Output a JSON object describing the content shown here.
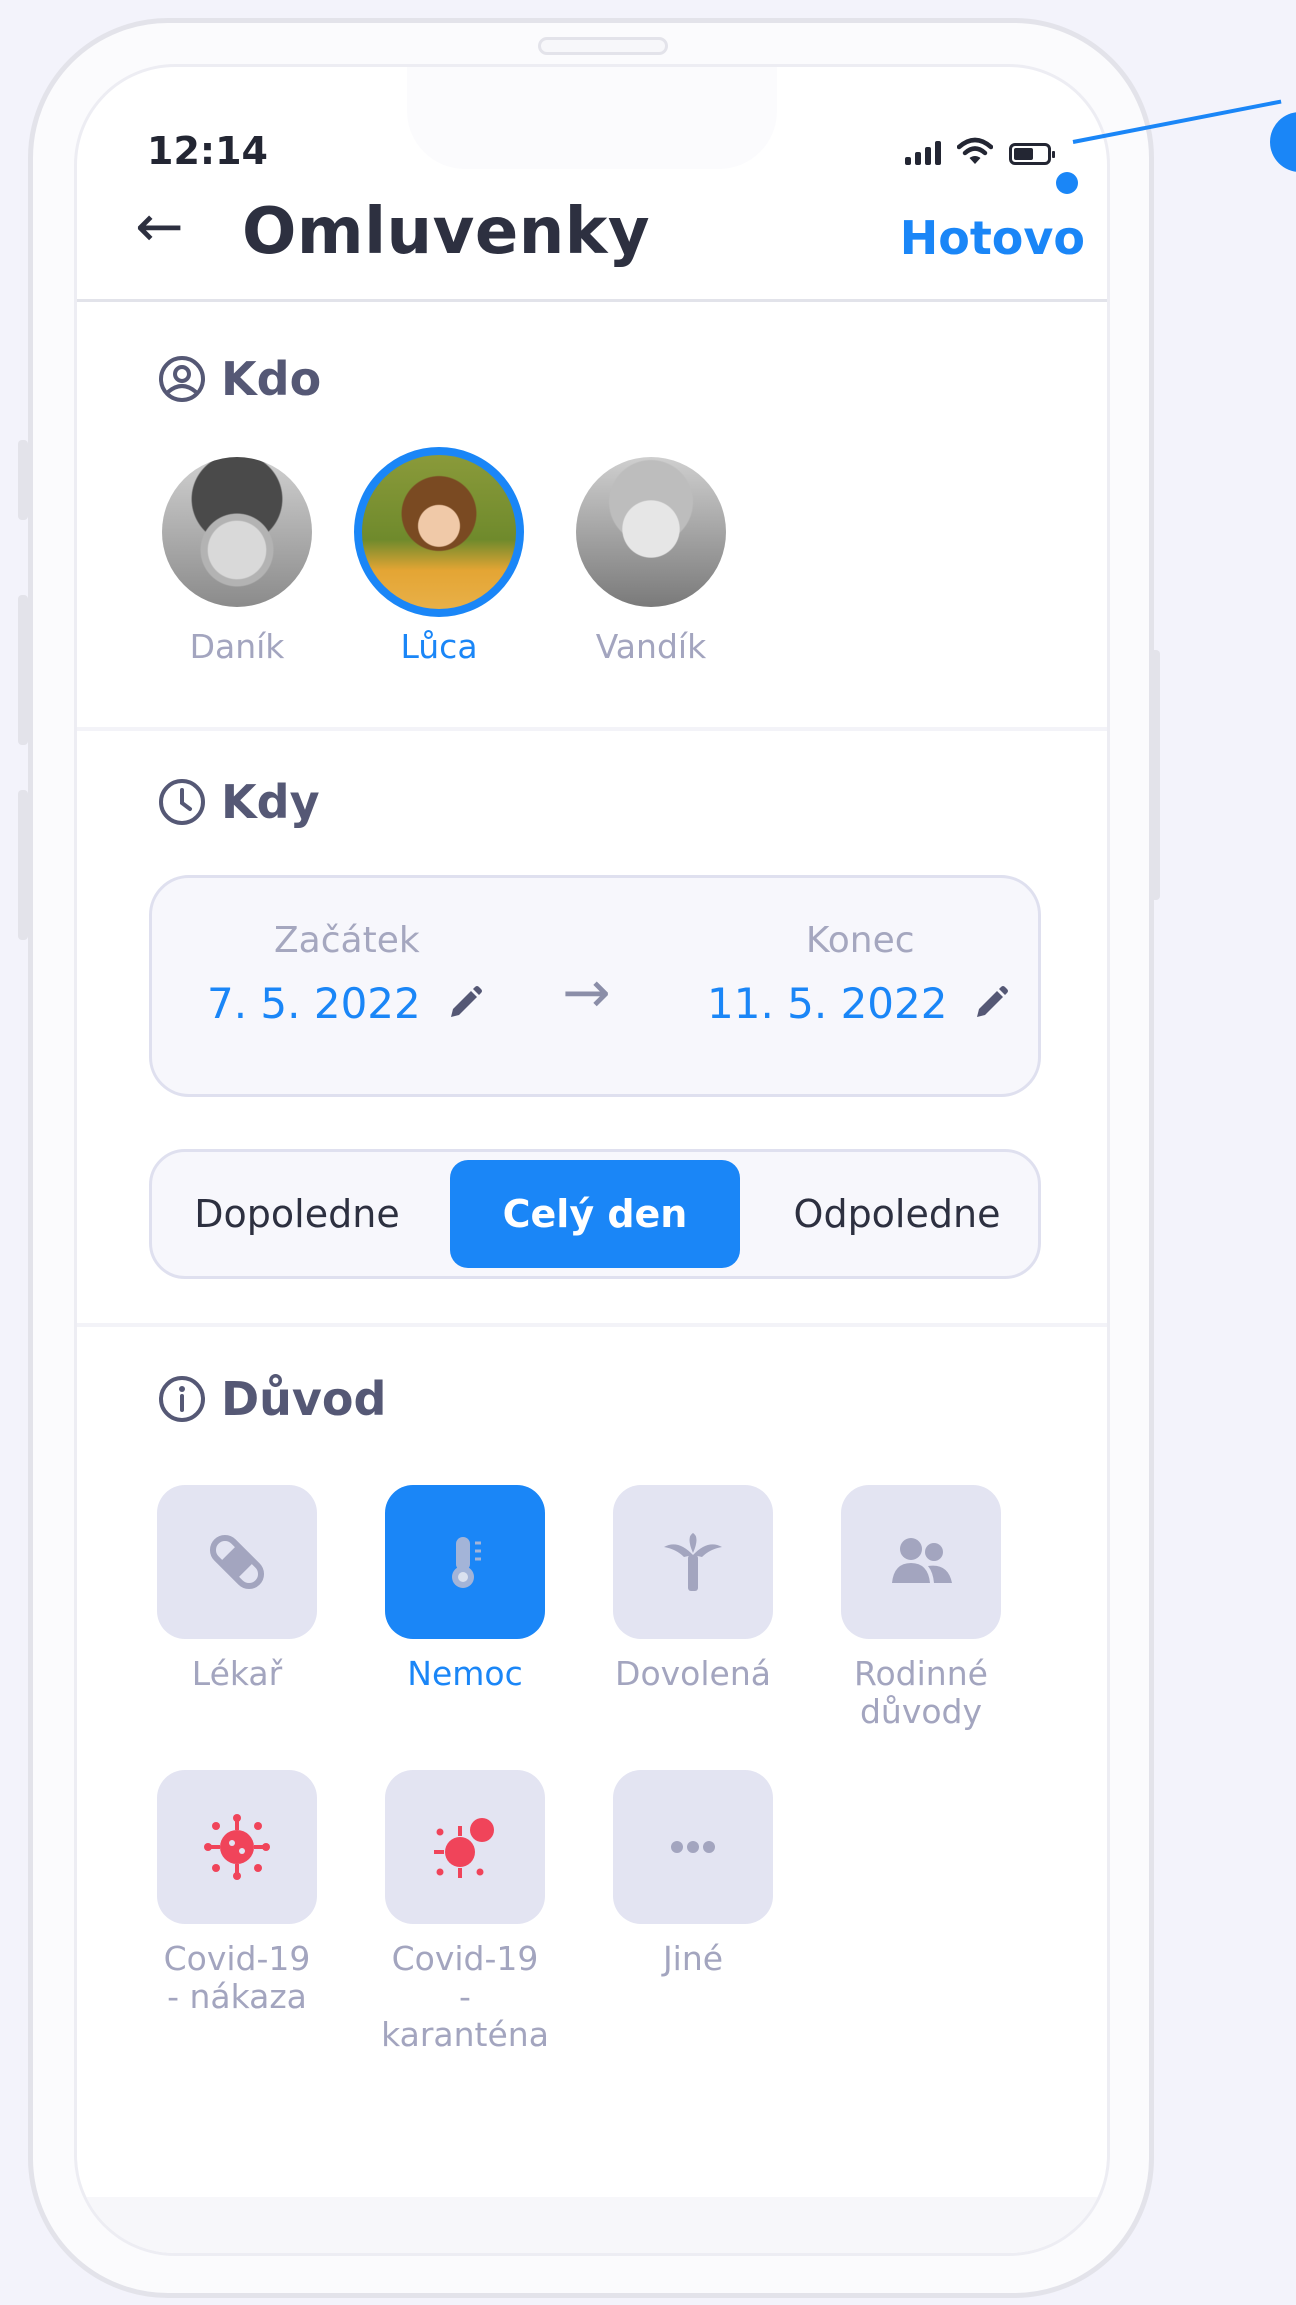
{
  "status": {
    "time": "12:14"
  },
  "header": {
    "title": "Omluvenky",
    "done_label": "Hotovo"
  },
  "who": {
    "title": "Kdo",
    "kids": [
      {
        "name": "Daník",
        "selected": false
      },
      {
        "name": "Lůca",
        "selected": true
      },
      {
        "name": "Vandík",
        "selected": false
      }
    ]
  },
  "when": {
    "title": "Kdy",
    "start_label": "Začátek",
    "start_value": "7. 5. 2022",
    "end_label": "Konec",
    "end_value": "11. 5. 2022",
    "segments": [
      "Dopoledne",
      "Celý den",
      "Odpoledne"
    ],
    "selected_segment": "Celý den"
  },
  "reason": {
    "title": "Důvod",
    "items": [
      {
        "label": "Lékař",
        "icon": "bandage-icon",
        "selected": false
      },
      {
        "label": "Nemoc",
        "icon": "thermometer-icon",
        "selected": true
      },
      {
        "label": "Dovolená",
        "icon": "palm-tree-icon",
        "selected": false
      },
      {
        "label": "Rodinné důvody",
        "icon": "family-icon",
        "selected": false
      },
      {
        "label": "Covid-19 - nákaza",
        "icon": "virus-icon",
        "selected": false
      },
      {
        "label": "Covid-19 - karanténa",
        "icon": "virus-quarantine-icon",
        "selected": false
      },
      {
        "label": "Jiné",
        "icon": "more-icon",
        "selected": false
      }
    ]
  },
  "colors": {
    "accent": "#1a86f7",
    "covid": "#f0445a",
    "tile": "#e3e4f2"
  }
}
